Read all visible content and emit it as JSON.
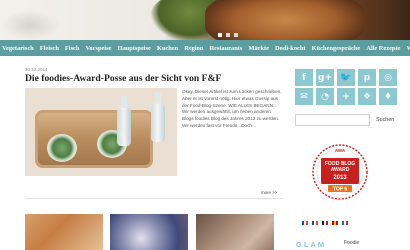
{
  "nav": {
    "items": [
      "Vegetarisch",
      "Fleisch",
      "Fisch",
      "Vorspeise",
      "Hauptspeise",
      "Kuchen",
      "Region",
      "Restaurants",
      "Märkte",
      "Dodi-kocht",
      "Küchengespräche",
      "Alle Rezepte",
      "W"
    ]
  },
  "post": {
    "date": "30.12.2014",
    "title": "Die foodies-Award-Posse aus der Sicht von F&F",
    "excerpt": "Okay. Dieser Artikel ist zum Löcken geschrieben. Aber er ist vorerst nötig. Hier etwas Gossip aus der Food-Blog-Szene. WIE ALLES BEGANN… Wir werden ausgewählt, um neben anderen Blogs foodies Blog des Jahres 2013 zu werden. Wir werden fast vor Freude...Doch…",
    "more_label": "more >>"
  },
  "sidebar": {
    "social": [
      {
        "icon": "facebook-icon",
        "glyph": "f"
      },
      {
        "icon": "google-plus-icon",
        "glyph": "g+"
      },
      {
        "icon": "twitter-icon",
        "glyph": "🐦"
      },
      {
        "icon": "pinterest-icon",
        "glyph": "p"
      },
      {
        "icon": "instagram-icon",
        "glyph": "◎"
      },
      {
        "icon": "email-icon",
        "glyph": "✉"
      },
      {
        "icon": "rss-icon",
        "glyph": "◔"
      },
      {
        "icon": "bloglovin-icon",
        "glyph": "+"
      },
      {
        "icon": "heart-icon",
        "glyph": "❖"
      },
      {
        "icon": "star-icon",
        "glyph": "♦"
      }
    ],
    "search_placeholder": "",
    "search_label": "Suchen",
    "award": {
      "brand": "AMA",
      "line1": "FOOD BLOG",
      "line2": "AWARD",
      "year": "2013",
      "rank": "TOP 6"
    },
    "flags": [
      {
        "label": "",
        "colors": [
          "#0055a4",
          "#ffffff",
          "#ef4135"
        ]
      },
      {
        "label": "",
        "colors": [
          "#0055a4",
          "#ffffff",
          "#ef4135"
        ]
      },
      {
        "label": "",
        "colors": [
          "#012169",
          "#ffffff",
          "#c8102e"
        ]
      },
      {
        "label": "",
        "colors": [
          "#aa151b",
          "#f1bf00",
          "#aa151b"
        ]
      },
      {
        "label": "",
        "colors": [
          "#009246",
          "#ffffff",
          "#ce2b37"
        ]
      }
    ],
    "glam_label": "GLAM",
    "foodie_label": "Foodie"
  },
  "colors": {
    "nav_bg": "#5c9e9f",
    "social_bg": "#8cc8cf",
    "award_red": "#c8201e"
  }
}
